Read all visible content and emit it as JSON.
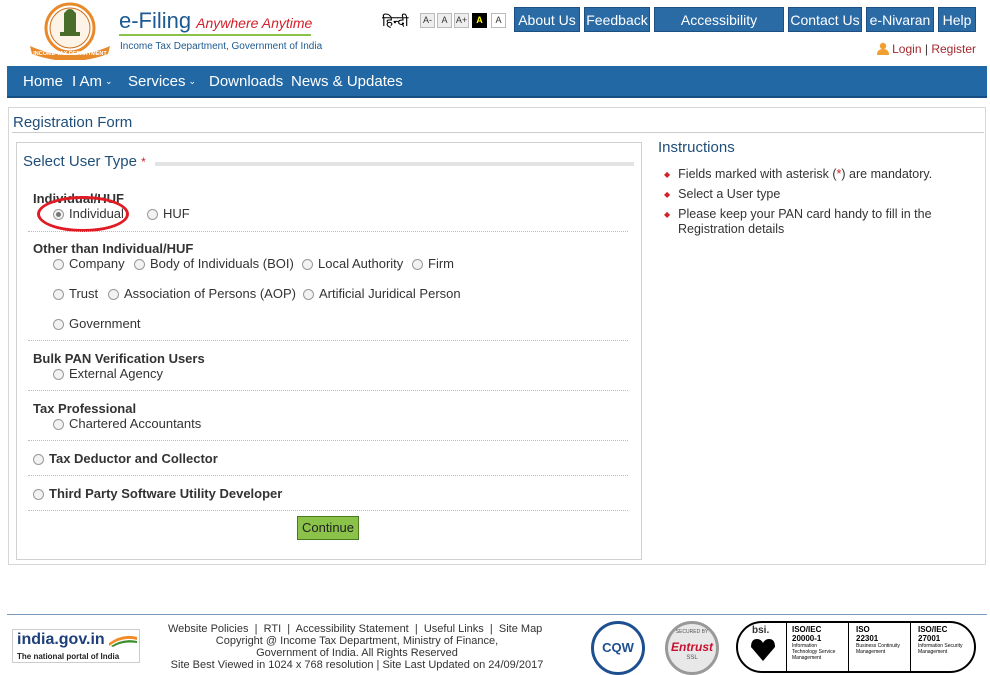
{
  "header": {
    "brand_title": "e-Filing",
    "brand_tagline": "Anywhere Anytime",
    "brand_subtitle": "Income Tax Department, Government of India",
    "emblem_ribbon": "INCOME TAX DEPARTMENT",
    "language_link": "हिन्दी",
    "font_size_buttons": [
      "A-",
      "A",
      "A+",
      "A",
      "A"
    ],
    "top_buttons": [
      "About Us",
      "Feedback",
      "Accessibility Options",
      "Contact Us",
      "e-Nivaran",
      "Help"
    ],
    "login_label": "Login",
    "register_label": "Register",
    "separator": "|"
  },
  "nav": {
    "items": [
      {
        "label": "Home"
      },
      {
        "label": "I Am",
        "caret": "⌄"
      },
      {
        "label": "Services",
        "caret": "⌄"
      },
      {
        "label": "Downloads"
      },
      {
        "label": "News & Updates"
      }
    ]
  },
  "form": {
    "title": "Registration Form",
    "legend": "Select User Type",
    "required_mark": "*",
    "groups": {
      "individual_huf": {
        "label": "Individual/HUF",
        "options": [
          {
            "label": "Individual",
            "selected": true
          },
          {
            "label": "HUF",
            "selected": false
          }
        ]
      },
      "other": {
        "label": "Other than Individual/HUF",
        "options": [
          {
            "label": "Company"
          },
          {
            "label": "Body of Individuals (BOI)"
          },
          {
            "label": "Local Authority"
          },
          {
            "label": "Firm"
          },
          {
            "label": "Trust"
          },
          {
            "label": "Association of Persons (AOP)"
          },
          {
            "label": "Artificial Juridical Person"
          },
          {
            "label": "Government"
          }
        ]
      },
      "bulk_pan": {
        "label": "Bulk PAN Verification Users",
        "options": [
          {
            "label": "External Agency"
          }
        ]
      },
      "tax_professional": {
        "label": "Tax Professional",
        "options": [
          {
            "label": "Chartered Accountants"
          }
        ]
      }
    },
    "tax_deductor": "Tax Deductor and Collector",
    "third_party": "Third Party Software Utility Developer",
    "continue_label": "Continue"
  },
  "instructions": {
    "title": "Instructions",
    "bullet": "◆",
    "item1_prefix": "Fields marked with asterisk (",
    "item1_mark": "*",
    "item1_suffix": ") are mandatory.",
    "item2": "Select a User type",
    "item3": "Please keep your PAN card handy to fill in the Registration details"
  },
  "footer": {
    "india_gov_title": "india.gov.in",
    "india_gov_sub": "The national portal of India",
    "links": [
      "Website Policies",
      "RTI",
      "Accessibility Statement",
      "Useful Links",
      "Site Map"
    ],
    "link_separator": "|",
    "copyright_line1": "Copyright @ Income Tax Department, Ministry of Finance,",
    "copyright_line2": "Government of India. All Rights Reserved",
    "copyright_line3": "Site Best Viewed in 1024 x 768 resolution | Site Last Updated on 24/09/2017",
    "cqw_label": "CQW",
    "entrust_label": "Entrust",
    "entrust_small": "SECURED BY",
    "entrust_ssl": "SSL",
    "bsi_label": "bsi.",
    "iso_certs": [
      {
        "code": "ISO/IEC",
        "num": "20000-1",
        "desc": "Information Technology Service Management"
      },
      {
        "code": "ISO",
        "num": "22301",
        "desc": "Business Continuity Management"
      },
      {
        "code": "ISO/IEC",
        "num": "27001",
        "desc": "Information Security Management"
      }
    ]
  },
  "colors": {
    "nav_blue": "#2268a5",
    "title_blue": "#1f4e79",
    "accent_red": "#d3202a",
    "continue_green": "#8bc24a",
    "annotation_red": "#e01b24"
  }
}
